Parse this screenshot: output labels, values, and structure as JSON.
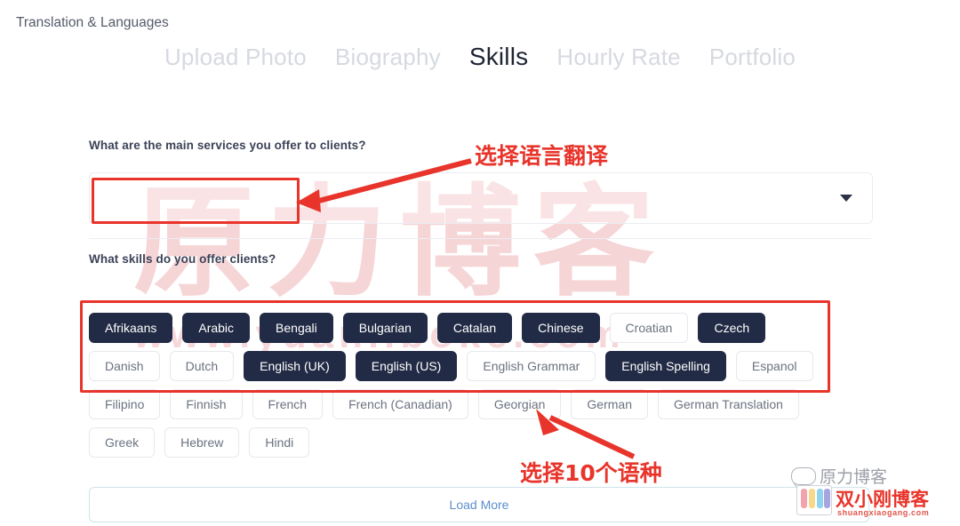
{
  "tabs": [
    {
      "label": "Upload Photo",
      "active": false
    },
    {
      "label": "Biography",
      "active": false
    },
    {
      "label": "Skills",
      "active": true
    },
    {
      "label": "Hourly Rate",
      "active": false
    },
    {
      "label": "Portfolio",
      "active": false
    }
  ],
  "form": {
    "services_question": "What are the main services you offer to clients?",
    "service_selected": "Translation & Languages",
    "skills_question": "What skills do you offer clients?",
    "caret_icon": "chevron-down-icon"
  },
  "skills": {
    "rows": [
      [
        {
          "label": "Afrikaans",
          "selected": true
        },
        {
          "label": "Arabic",
          "selected": true
        },
        {
          "label": "Bengali",
          "selected": true
        },
        {
          "label": "Bulgarian",
          "selected": true
        },
        {
          "label": "Catalan",
          "selected": true
        },
        {
          "label": "Chinese",
          "selected": true
        },
        {
          "label": "Croatian",
          "selected": false
        },
        {
          "label": "Czech",
          "selected": true
        }
      ],
      [
        {
          "label": "Danish",
          "selected": false
        },
        {
          "label": "Dutch",
          "selected": false
        },
        {
          "label": "English (UK)",
          "selected": true
        },
        {
          "label": "English (US)",
          "selected": true
        },
        {
          "label": "English Grammar",
          "selected": false
        },
        {
          "label": "English Spelling",
          "selected": true
        },
        {
          "label": "Espanol",
          "selected": false
        }
      ],
      [
        {
          "label": "Filipino",
          "selected": false
        },
        {
          "label": "Finnish",
          "selected": false
        },
        {
          "label": "French",
          "selected": false
        },
        {
          "label": "French (Canadian)",
          "selected": false
        },
        {
          "label": "Georgian",
          "selected": false
        },
        {
          "label": "German",
          "selected": false
        },
        {
          "label": "German Translation",
          "selected": false
        }
      ],
      [
        {
          "label": "Greek",
          "selected": false
        },
        {
          "label": "Hebrew",
          "selected": false
        },
        {
          "label": "Hindi",
          "selected": false
        }
      ]
    ]
  },
  "load_more": {
    "label": "Load More"
  },
  "annotations": {
    "note_select": "选择语言翻译",
    "note_skills": "选择10个语种",
    "color": "#e8342a"
  },
  "watermarks": {
    "big_text": "原力博客",
    "url_text": "www.yuanliboke.com",
    "logo_top": "原力博客",
    "logo_main": "双小刚博客",
    "logo_domain": "shuangxiaogang.com",
    "wechat_icon": "wechat-icon"
  }
}
